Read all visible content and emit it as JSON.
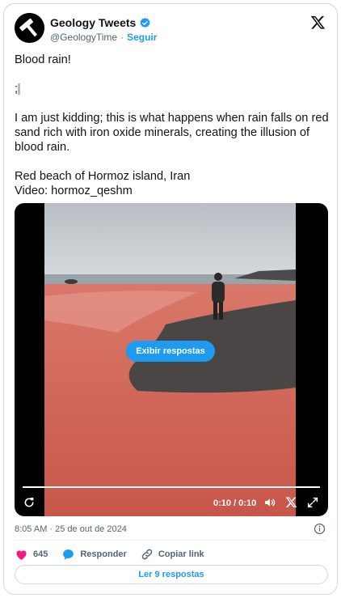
{
  "author": {
    "display_name": "Geology Tweets",
    "handle": "@GeologyTime",
    "follow_label": "Seguir",
    "separator": "·"
  },
  "tweet": {
    "line1": "Blood rain!",
    "line2": ";",
    "line3": "I am just kidding; this is what happens when rain falls on red sand rich with iron oxide minerals, creating the illusion of blood rain.",
    "line4": "Red beach of Hormoz island, Iran",
    "line5": "Video: hormoz_qeshm"
  },
  "media": {
    "overlay_button": "Exibir respostas",
    "time": "0:10 / 0:10",
    "progress": 1.0,
    "controls": [
      "replay-icon",
      "volume-icon",
      "x-logo-icon",
      "fullscreen-icon"
    ]
  },
  "footer": {
    "timestamp": "8:05 AM · 25 de out de 2024",
    "like_count": "645",
    "reply_label": "Responder",
    "copy_label": "Copiar link",
    "read_replies": "Ler 9 respostas"
  },
  "colors": {
    "accent": "#1d9bf0",
    "like": "#f91880",
    "text": "#0f1419",
    "muted": "#536471"
  }
}
